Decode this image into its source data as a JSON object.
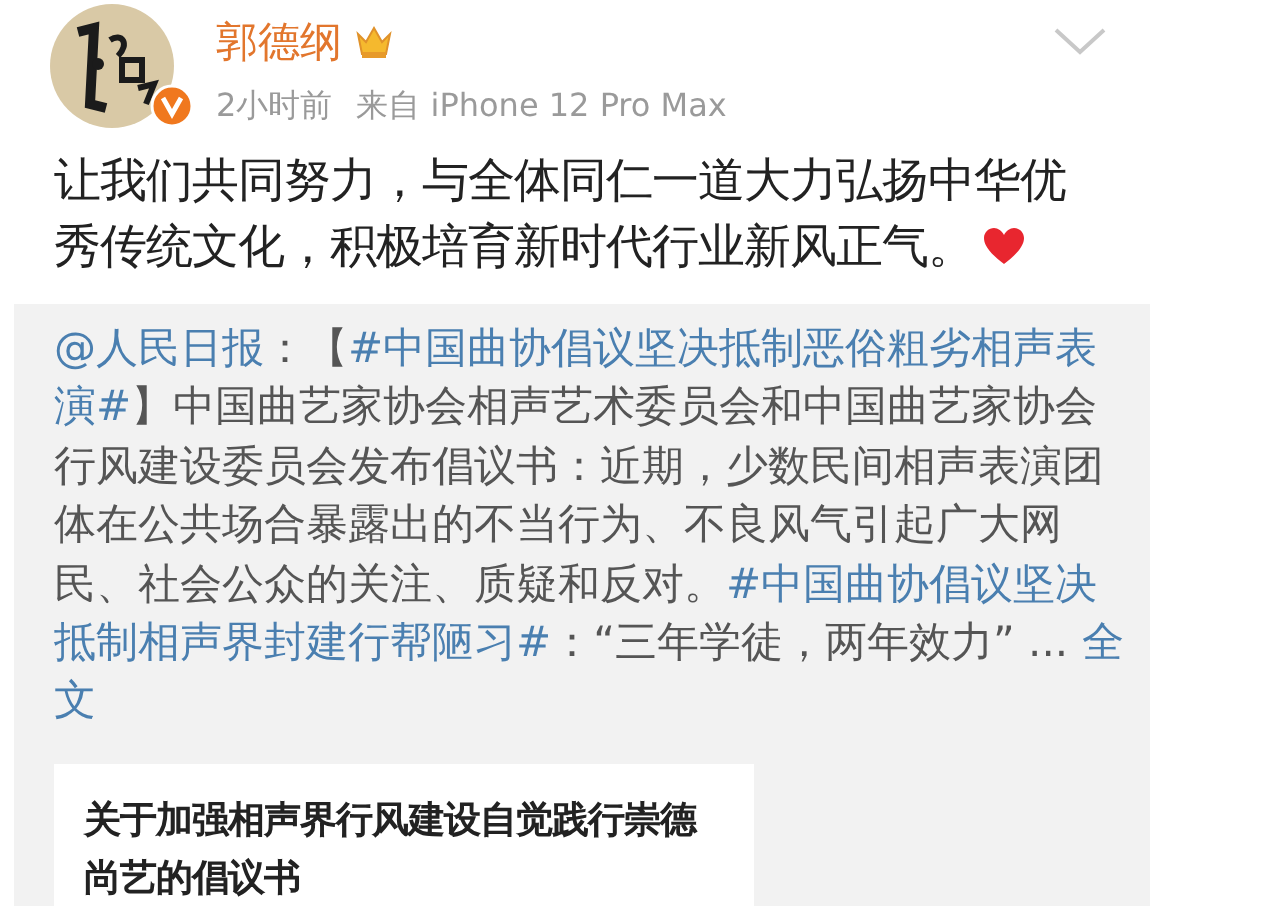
{
  "author": {
    "name": "郭德纲",
    "crowned": true,
    "verified": true
  },
  "meta": {
    "time": "2小时前",
    "source": "来自 iPhone 12 Pro Max"
  },
  "post": {
    "text": "让我们共同努力，与全体同仁一道大力弘扬中华优秀传统文化，积极培育新时代行业新风正气。",
    "heart": true
  },
  "repost": {
    "segments": [
      {
        "kind": "link",
        "text": "@人民日报"
      },
      {
        "kind": "text",
        "text": "：【"
      },
      {
        "kind": "link",
        "text": "#中国曲协倡议坚决抵制恶俗粗劣相声表演#"
      },
      {
        "kind": "text",
        "text": "】中国曲艺家协会相声艺术委员会和中国曲艺家协会行风建设委员会发布倡议书：近期，少数民间相声表演团体在公共场合暴露出的不当行为、不良风气引起广大网民、社会公众的关注、质疑和反对。"
      },
      {
        "kind": "link",
        "text": "#中国曲协倡议坚决抵制相声界封建行帮陋习#"
      },
      {
        "kind": "text",
        "text": "：“三年学徒，两年效力” ... "
      },
      {
        "kind": "link",
        "text": "全文"
      }
    ],
    "card": {
      "title": "关于加强相声界行风建设自觉践行崇德尚艺的倡议书"
    }
  }
}
